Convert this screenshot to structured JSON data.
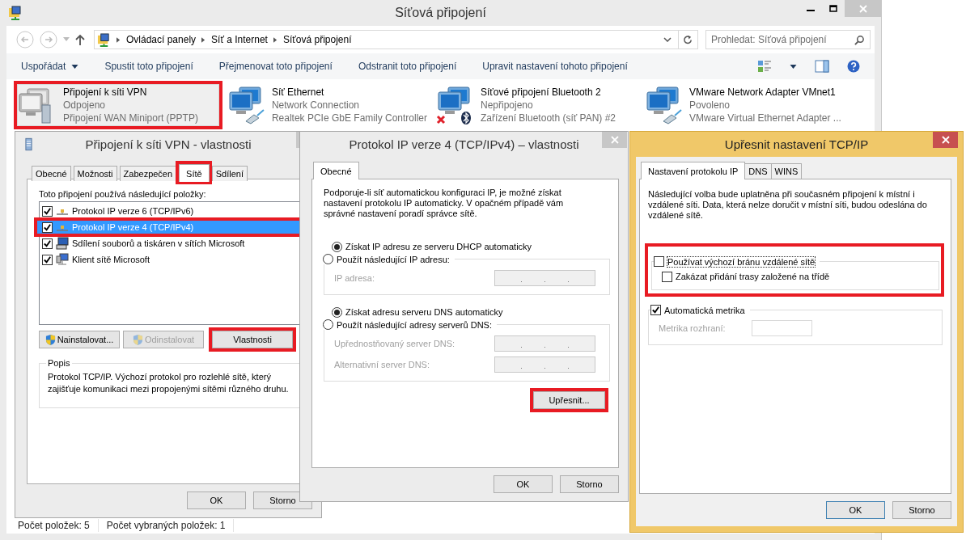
{
  "window": {
    "title": "Síťová připojení"
  },
  "address_bar": {
    "crumbs": [
      "Ovládací panely",
      "Síť a Internet",
      "Síťová připojení"
    ]
  },
  "search": {
    "placeholder": "Prohledat: Síťová připojení"
  },
  "toolbar": [
    {
      "label": "Uspořádat",
      "dropdown": true
    },
    {
      "label": "Spustit toto připojení",
      "dropdown": false
    },
    {
      "label": "Přejmenovat toto připojení",
      "dropdown": false
    },
    {
      "label": "Odstranit toto připojení",
      "dropdown": false
    },
    {
      "label": "Upravit nastavení tohoto připojení",
      "dropdown": false
    }
  ],
  "connections": [
    {
      "name": "Připojení k síti VPN",
      "status": "Odpojeno",
      "device": "Připojení WAN Miniport (PPTP)",
      "kind": "vpn",
      "selected": true,
      "highlighted": true
    },
    {
      "name": "Síť Ethernet",
      "status": "Network Connection",
      "device": "Realtek PCIe GbE Family Controller",
      "kind": "ethernet",
      "selected": false,
      "highlighted": false
    },
    {
      "name": "Síťové připojení Bluetooth 2",
      "status": "Nepřipojeno",
      "device": "Zařízení Bluetooth (síť PAN) #2",
      "kind": "bluetooth",
      "selected": false,
      "highlighted": false
    },
    {
      "name": "VMware Network Adapter VMnet1",
      "status": "Povoleno",
      "device": "VMware Virtual Ethernet Adapter ...",
      "kind": "ethernet",
      "selected": false,
      "highlighted": false
    }
  ],
  "status_bar": [
    "Počet položek: 5",
    "Počet vybraných položek: 1"
  ],
  "vpn_dialog": {
    "title": "Připojení k síti VPN - vlastnosti",
    "tabs": [
      {
        "label": "Obecné",
        "selected": false,
        "highlighted": false
      },
      {
        "label": "Možnosti",
        "selected": false,
        "highlighted": false
      },
      {
        "label": "Zabezpečen",
        "selected": false,
        "highlighted": false
      },
      {
        "label": "Sítě",
        "selected": true,
        "highlighted": true
      },
      {
        "label": "Sdílení",
        "selected": false,
        "highlighted": false
      }
    ],
    "items_label": "Toto připojení používá následující položky:",
    "items": [
      {
        "label": "Protokol IP verze 6 (TCP/IPv6)",
        "kind": "protocol",
        "checked": true,
        "selected": false,
        "highlighted": false
      },
      {
        "label": "Protokol IP verze 4 (TCP/IPv4)",
        "kind": "protocol",
        "checked": true,
        "selected": true,
        "highlighted": true
      },
      {
        "label": "Sdílení souborů a tiskáren v sítích Microsoft",
        "kind": "service",
        "checked": true,
        "selected": false,
        "highlighted": false
      },
      {
        "label": "Klient sítě Microsoft",
        "kind": "client",
        "checked": true,
        "selected": false,
        "highlighted": false
      }
    ],
    "buttons": [
      {
        "label": "Nainstalovat...",
        "shield": true,
        "disabled": false,
        "highlighted": false
      },
      {
        "label": "Odinstalovat",
        "shield": true,
        "disabled": true,
        "highlighted": false
      },
      {
        "label": "Vlastnosti",
        "shield": false,
        "disabled": false,
        "highlighted": true
      }
    ],
    "description": {
      "legend": "Popis",
      "text": "Protokol TCP/IP. Výchozí protokol pro rozlehlé sítě, který zajišťuje komunikaci mezi propojenými sítěmi různého druhu."
    },
    "footer_buttons": [
      "OK",
      "Storno"
    ]
  },
  "ipv4_dialog": {
    "title": "Protokol IP verze 4 (TCP/IPv4) – vlastnosti",
    "tabs": [
      {
        "label": "Obecné",
        "selected": true
      }
    ],
    "intro": "Podporuje-li síť automatickou konfiguraci IP, je možné získat nastavení protokolu IP automaticky. V opačném případě vám správné nastavení poradí správce sítě.",
    "ip_options": [
      {
        "label": "Získat IP adresu ze serveru DHCP automaticky",
        "selected": true
      },
      {
        "label": "Použít následující IP adresu:",
        "selected": false
      }
    ],
    "ip_fields": [
      {
        "label": "IP adresa:",
        "disabled": true
      }
    ],
    "dns_options": [
      {
        "label": "Získat adresu serveru DNS automaticky",
        "selected": true
      },
      {
        "label": "Použít následující adresy serverů DNS:",
        "selected": false
      }
    ],
    "dns_fields": [
      {
        "label": "Upřednostňovaný server DNS:",
        "disabled": true
      },
      {
        "label": "Alternativní server DNS:",
        "disabled": true
      }
    ],
    "advanced_button": {
      "label": "Upřesnit...",
      "highlighted": true
    },
    "footer_buttons": [
      "OK",
      "Storno"
    ]
  },
  "advanced_dialog": {
    "title": "Upřesnit nastavení TCP/IP",
    "tabs": [
      {
        "label": "Nastavení protokolu IP",
        "selected": true
      },
      {
        "label": "DNS",
        "selected": false
      },
      {
        "label": "WINS",
        "selected": false
      }
    ],
    "intro": "Následující volba bude uplatněna při současném připojení k místní i vzdálené síti. Data, která nelze doručit v místní síti, budou odeslána do vzdálené sítě.",
    "gateway": {
      "highlighted": true,
      "options": [
        {
          "label": "Používat výchozí bránu vzdálené sítě",
          "checked": false
        },
        {
          "label": "Zakázat přidání trasy založené na třídě",
          "checked": false
        }
      ]
    },
    "metric": {
      "label": "Automatická metrika",
      "checked": true,
      "field_label": "Metrika rozhraní:",
      "field_disabled": true
    },
    "footer_buttons": [
      "OK",
      "Storno"
    ]
  }
}
